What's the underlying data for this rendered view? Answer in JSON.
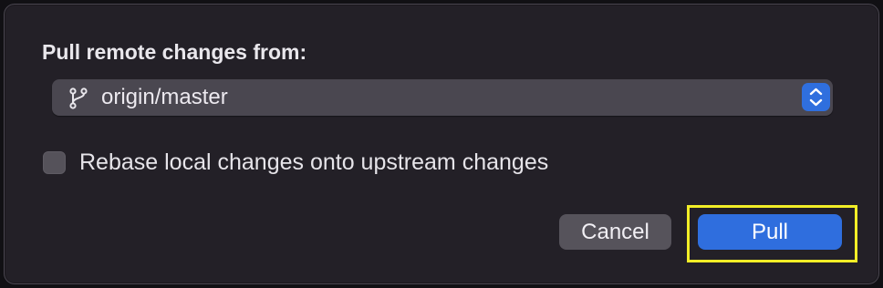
{
  "dialog": {
    "heading": "Pull remote changes from:",
    "remote_select": {
      "icon": "branch-icon",
      "value": "origin/master",
      "stepper_icon": "up-down-chevron-icon"
    },
    "rebase_checkbox": {
      "checked": false,
      "label": "Rebase local changes onto upstream changes"
    },
    "buttons": {
      "cancel_label": "Cancel",
      "pull_label": "Pull"
    },
    "colors": {
      "accent": "#2f6ede",
      "highlight": "#f2ee27"
    }
  }
}
